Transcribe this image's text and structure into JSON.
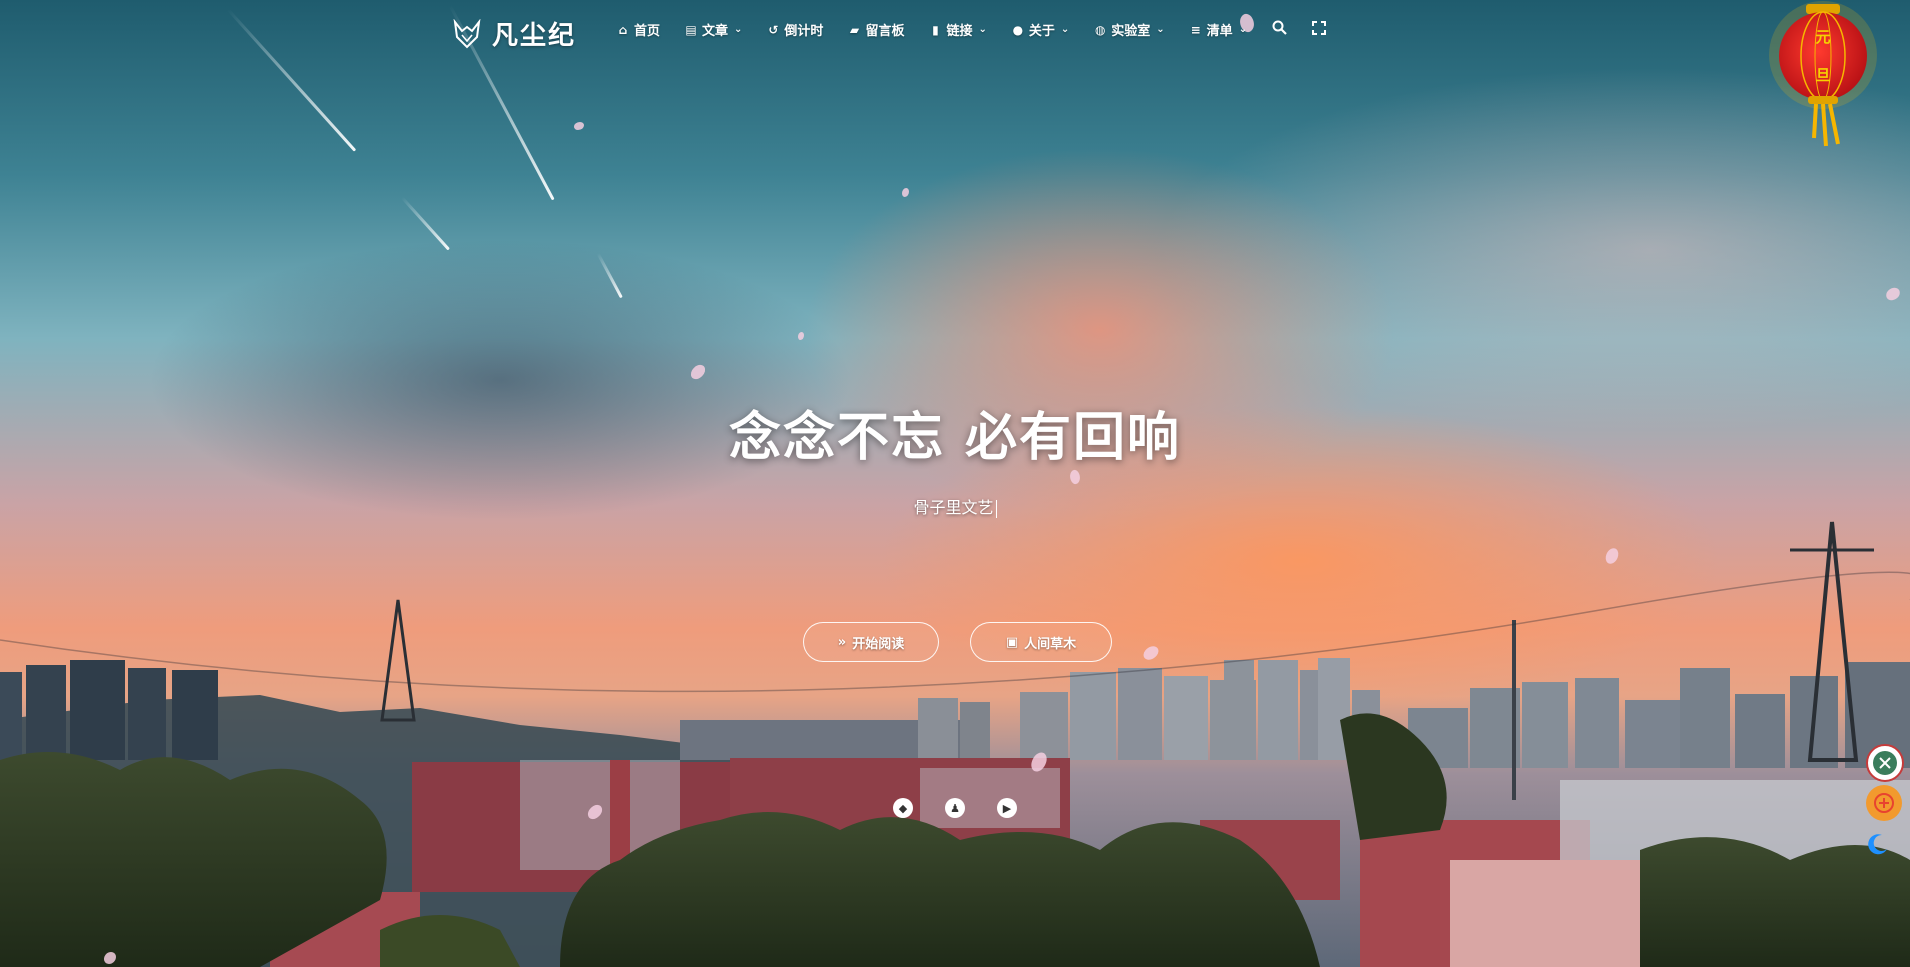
{
  "site": {
    "title": "凡尘纪"
  },
  "nav": {
    "items": [
      {
        "label": "首页",
        "icon": "home-icon",
        "has_dropdown": false
      },
      {
        "label": "文章",
        "icon": "book-icon",
        "has_dropdown": true
      },
      {
        "label": "倒计时",
        "icon": "history-icon",
        "has_dropdown": false
      },
      {
        "label": "留言板",
        "icon": "comments-icon",
        "has_dropdown": false
      },
      {
        "label": "链接",
        "icon": "bookmark-icon",
        "has_dropdown": true
      },
      {
        "label": "关于",
        "icon": "user-circle-icon",
        "has_dropdown": true
      },
      {
        "label": "实验室",
        "icon": "flask-icon",
        "has_dropdown": true
      },
      {
        "label": "清单",
        "icon": "list-icon",
        "has_dropdown": true
      }
    ],
    "tools": [
      "search-icon",
      "fullscreen-icon"
    ]
  },
  "lantern": {
    "text": [
      "元",
      "旦"
    ]
  },
  "hero": {
    "title": "念念不忘 必有回响",
    "subtitle": "骨子里文艺",
    "buttons": [
      {
        "label": "开始阅读",
        "icon": "double-chevron-down-icon"
      },
      {
        "label": "人间草木",
        "icon": "robot-icon"
      }
    ],
    "socials": [
      "bilibili-icon",
      "qq-icon",
      "play-circle-icon"
    ]
  },
  "side_widgets": [
    "music-player-icon",
    "gift-icon",
    "moon-icon"
  ],
  "colors": {
    "accent": "#ffffff",
    "lantern": "#d3171c",
    "lantern_trim": "#f6b600",
    "moon": "#1e90ff"
  }
}
